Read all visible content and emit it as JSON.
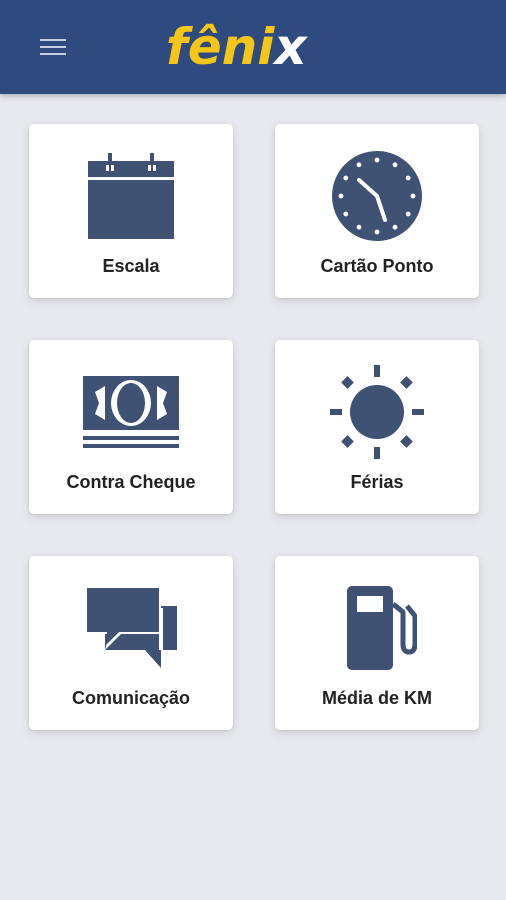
{
  "app": {
    "brand": "fênix",
    "colors": {
      "header": "#2e4a7e",
      "icon": "#3f5273",
      "logo_yellow": "#f5c518",
      "background": "#e8e9ee"
    }
  },
  "header": {
    "menu_icon": "hamburger-menu-icon"
  },
  "menu": {
    "items": [
      {
        "label": "Escala",
        "icon": "calendar-icon"
      },
      {
        "label": "Cartão Ponto",
        "icon": "clock-icon"
      },
      {
        "label": "Contra Cheque",
        "icon": "banknote-icon"
      },
      {
        "label": "Férias",
        "icon": "sun-icon"
      },
      {
        "label": "Comunicação",
        "icon": "chat-bubbles-icon"
      },
      {
        "label": "Média de KM",
        "icon": "fuel-pump-icon"
      }
    ]
  }
}
